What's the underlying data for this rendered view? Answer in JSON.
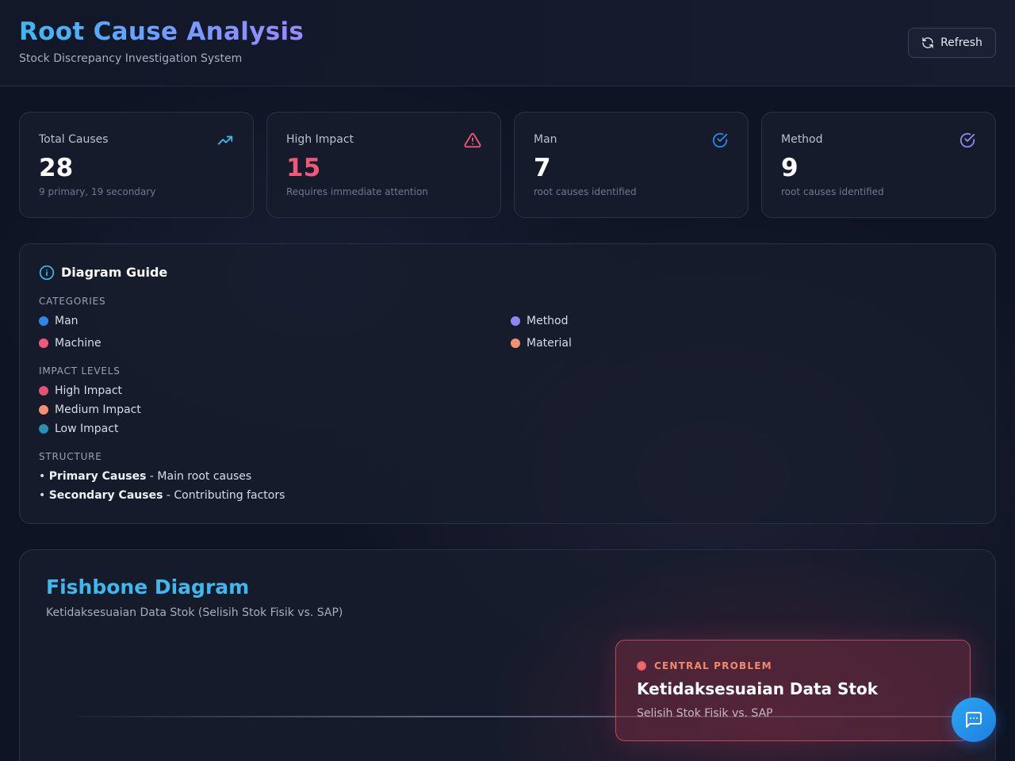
{
  "header": {
    "title": "Root Cause Analysis",
    "subtitle": "Stock Discrepancy Investigation System",
    "refresh_label": "Refresh"
  },
  "stats": [
    {
      "label": "Total Causes",
      "value": "28",
      "note": "9 primary, 19 secondary",
      "icon": "trending-up-icon",
      "color": "#3db8f0"
    },
    {
      "label": "High Impact",
      "value": "15",
      "note": "Requires immediate attention",
      "icon": "alert-triangle-icon",
      "color": "#f0587a"
    },
    {
      "label": "Man",
      "value": "7",
      "note": "root causes identified",
      "icon": "check-circle-icon",
      "color": "#2f86e8"
    },
    {
      "label": "Method",
      "value": "9",
      "note": "root causes identified",
      "icon": "check-circle-icon",
      "color": "#8f86f0"
    }
  ],
  "guide": {
    "title": "Diagram Guide",
    "categories_heading": "CATEGORIES",
    "categories": [
      {
        "label": "Man",
        "color": "#2f86e8"
      },
      {
        "label": "Method",
        "color": "#8f86f0"
      },
      {
        "label": "Machine",
        "color": "#f0587a"
      },
      {
        "label": "Material",
        "color": "#f58f72"
      }
    ],
    "impact_heading": "IMPACT LEVELS",
    "impacts": [
      {
        "label": "High Impact",
        "color": "#e0566e"
      },
      {
        "label": "Medium Impact",
        "color": "#f58f72"
      },
      {
        "label": "Low Impact",
        "color": "#2a8fb0"
      }
    ],
    "structure_heading": "STRUCTURE",
    "structure": [
      {
        "bold": "Primary Causes",
        "text": " - Main root causes"
      },
      {
        "bold": "Secondary Causes",
        "text": " - Contributing factors"
      }
    ]
  },
  "fishbone": {
    "title": "Fishbone Diagram",
    "subtitle": "Ketidaksesuaian Data Stok (Selisih Stok Fisik vs. SAP)",
    "central_tag": "CENTRAL PROBLEM",
    "central_title": "Ketidaksesuaian Data Stok",
    "central_sub": "Selisih Stok Fisik vs. SAP"
  },
  "chat": {
    "icon": "chat-icon"
  }
}
